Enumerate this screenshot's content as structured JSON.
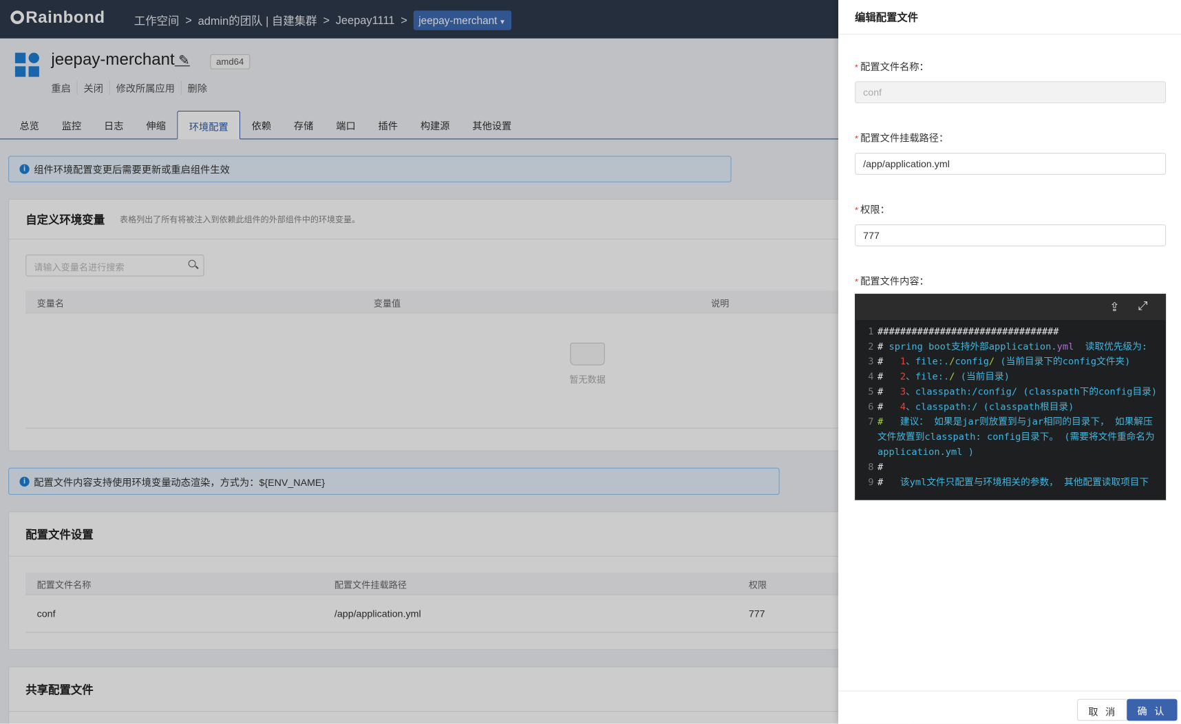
{
  "header": {
    "logo": "Rainbond",
    "breadcrumbs": [
      "工作空间",
      ">",
      "admin的团队 | 自建集群",
      ">",
      "Jeepay1111",
      ">"
    ],
    "current_component": "jeepay-merchant"
  },
  "component": {
    "name": "jeepay-merchant",
    "arch": "amd64",
    "actions": [
      "重启",
      "关闭",
      "修改所属应用",
      "删除"
    ]
  },
  "tabs": [
    "总览",
    "监控",
    "日志",
    "伸缩",
    "环境配置",
    "依赖",
    "存储",
    "端口",
    "插件",
    "构建源",
    "其他设置"
  ],
  "alert1": "组件环境配置变更后需要更新或重启组件生效",
  "env": {
    "title": "自定义环境变量",
    "desc": "表格列出了所有将被注入到依赖此组件的外部组件中的环境变量。",
    "search_placeholder": "请输入变量名进行搜索",
    "columns": [
      "变量名",
      "变量值",
      "说明"
    ],
    "empty": "暂无数据"
  },
  "alert2": "配置文件内容支持使用环境变量动态渲染，方式为：${ENV_NAME}",
  "config": {
    "title": "配置文件设置",
    "columns": [
      "配置文件名称",
      "配置文件挂载路径",
      "权限"
    ],
    "rows": [
      [
        "conf",
        "/app/application.yml",
        "777"
      ]
    ]
  },
  "shared": {
    "title": "共享配置文件"
  },
  "drawer": {
    "title": "编辑配置文件",
    "name_label": "配置文件名称：",
    "name_value": "conf",
    "path_label": "配置文件挂载路径：",
    "path_value": "/app/application.yml",
    "perm_label": "权限：",
    "perm_value": "777",
    "content_label": "配置文件内容：",
    "cancel": "取 消",
    "confirm": "确 认",
    "code": [
      [
        {
          "t": "################################",
          "c": "h"
        }
      ],
      [
        {
          "t": "# ",
          "c": "h"
        },
        {
          "t": "spring boot支持外部application.",
          "c": "txt"
        },
        {
          "t": "yml",
          "c": "yml"
        },
        {
          "t": "  读取优先级为:",
          "c": "txt"
        }
      ],
      [
        {
          "t": "#   ",
          "c": "h"
        },
        {
          "t": "1",
          "c": "num"
        },
        {
          "t": "、file:.",
          "c": "txt"
        },
        {
          "t": "/",
          "c": "sl"
        },
        {
          "t": "config",
          "c": "txt"
        },
        {
          "t": "/",
          "c": "sl"
        },
        {
          "t": " (当前目录下的config文件夹)",
          "c": "txt"
        }
      ],
      [
        {
          "t": "#   ",
          "c": "h"
        },
        {
          "t": "2",
          "c": "num"
        },
        {
          "t": "、file:.",
          "c": "txt"
        },
        {
          "t": "/",
          "c": "sl"
        },
        {
          "t": " (当前目录)",
          "c": "txt"
        }
      ],
      [
        {
          "t": "#   ",
          "c": "h"
        },
        {
          "t": "3",
          "c": "num"
        },
        {
          "t": "、classpath:/config/ (classpath下的config目录)",
          "c": "txt"
        }
      ],
      [
        {
          "t": "#   ",
          "c": "h"
        },
        {
          "t": "4",
          "c": "num"
        },
        {
          "t": "、classpath:/ (classpath根目录)",
          "c": "txt"
        }
      ],
      [
        {
          "t": "#   ",
          "c": "hy"
        },
        {
          "t": "建议： 如果是jar则放置到与jar相同的目录下， 如果解压文件放置到classpath: config目录下。 (需要将文件重命名为 application.yml )",
          "c": "txt"
        }
      ],
      [
        {
          "t": "#",
          "c": "h"
        }
      ],
      [
        {
          "t": "#   ",
          "c": "h"
        },
        {
          "t": "该yml文件只配置与环境相关的参数， 其他配置读取项目下",
          "c": "txt"
        }
      ]
    ]
  },
  "colors": {
    "accent": "#3a62ad",
    "header_bg": "#2f3a4c",
    "required": "#f5222d"
  }
}
